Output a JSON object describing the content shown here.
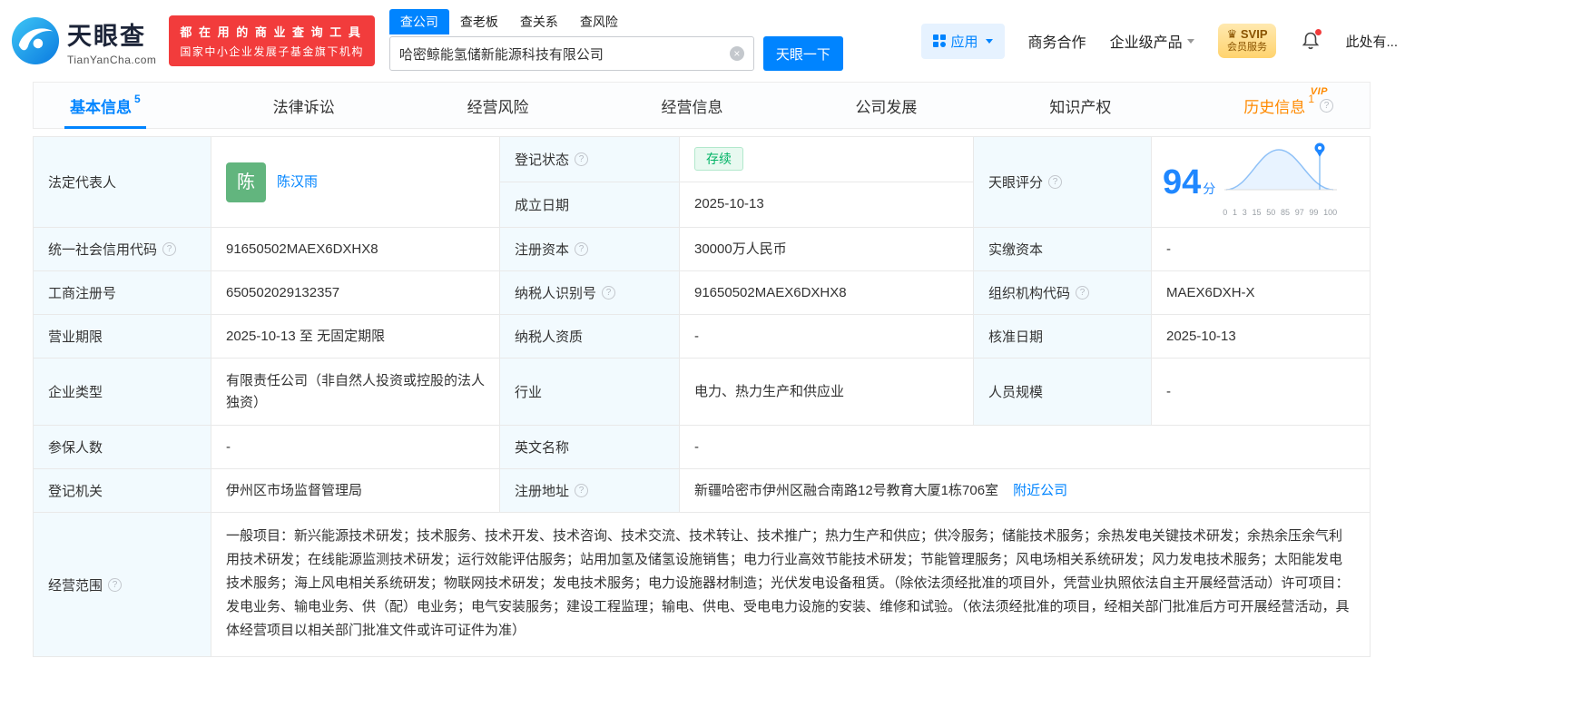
{
  "colors": {
    "brand_blue": "#0084ff",
    "promo_red": "#f23c3c",
    "status_green": "#00b365",
    "history_orange": "#ff8a00",
    "svip_gold": "#ffd36e",
    "label_cell_bg": "#f2fafe"
  },
  "header": {
    "logo_cn": "天眼查",
    "logo_en": "TianYanCha.com",
    "promo_line1": "都 在 用 的 商 业 查 询 工 具",
    "promo_line2": "国家中小企业发展子基金旗下机构",
    "search_tabs": [
      "查公司",
      "查老板",
      "查关系",
      "查风险"
    ],
    "search_value": "哈密鲸能氢储新能源科技有限公司",
    "search_button": "天眼一下",
    "nav_apps": "应用",
    "nav_cooperation": "商务合作",
    "nav_enterprise": "企业级产品",
    "svip_title": "SVIP",
    "svip_subtitle": "会员服务",
    "user_name": "此处有..."
  },
  "tabs": [
    {
      "label": "基本信息",
      "count": "5"
    },
    {
      "label": "法律诉讼",
      "count": ""
    },
    {
      "label": "经营风险",
      "count": ""
    },
    {
      "label": "经营信息",
      "count": ""
    },
    {
      "label": "公司发展",
      "count": ""
    },
    {
      "label": "知识产权",
      "count": ""
    },
    {
      "label": "历史信息",
      "count": "1",
      "vip": "VIP"
    }
  ],
  "info": {
    "legal_rep_label": "法定代表人",
    "legal_rep_avatar": "陈",
    "legal_rep_name": "陈汉雨",
    "reg_status_label": "登记状态",
    "reg_status_value": "存续",
    "establish_date_label": "成立日期",
    "establish_date_value": "2025-10-13",
    "score_label": "天眼评分",
    "score_value": "94",
    "score_unit": "分",
    "score_ticks": [
      "0",
      "1",
      "3",
      "15",
      "50",
      "85",
      "97",
      "99",
      "100"
    ],
    "credit_code_label": "统一社会信用代码",
    "credit_code_value": "91650502MAEX6DXHX8",
    "reg_capital_label": "注册资本",
    "reg_capital_value": "30000万人民币",
    "paid_capital_label": "实缴资本",
    "paid_capital_value": "-",
    "reg_number_label": "工商注册号",
    "reg_number_value": "650502029132357",
    "taxpayer_id_label": "纳税人识别号",
    "taxpayer_id_value": "91650502MAEX6DXHX8",
    "org_code_label": "组织机构代码",
    "org_code_value": "MAEX6DXH-X",
    "business_term_label": "营业期限",
    "business_term_value": "2025-10-13 至 无固定期限",
    "taxpayer_quality_label": "纳税人资质",
    "taxpayer_quality_value": "-",
    "approval_date_label": "核准日期",
    "approval_date_value": "2025-10-13",
    "company_type_label": "企业类型",
    "company_type_value": "有限责任公司（非自然人投资或控股的法人独资）",
    "industry_label": "行业",
    "industry_value": "电力、热力生产和供应业",
    "staff_size_label": "人员规模",
    "staff_size_value": "-",
    "insured_label": "参保人数",
    "insured_value": "-",
    "english_name_label": "英文名称",
    "english_name_value": "-",
    "reg_authority_label": "登记机关",
    "reg_authority_value": "伊州区市场监督管理局",
    "reg_address_label": "注册地址",
    "reg_address_value": "新疆哈密市伊州区融合南路12号教育大厦1栋706室",
    "nearby_link": "附近公司",
    "business_scope_label": "经营范围",
    "business_scope_value": "一般项目：新兴能源技术研发；技术服务、技术开发、技术咨询、技术交流、技术转让、技术推广；热力生产和供应；供冷服务；储能技术服务；余热发电关键技术研发；余热余压余气利用技术研发；在线能源监测技术研发；运行效能评估服务；站用加氢及储氢设施销售；电力行业高效节能技术研发；节能管理服务；风电场相关系统研发；风力发电技术服务；太阳能发电技术服务；海上风电相关系统研发；物联网技术研发；发电技术服务；电力设施器材制造；光伏发电设备租赁。（除依法须经批准的项目外，凭营业执照依法自主开展经营活动）许可项目：发电业务、输电业务、供（配）电业务；电气安装服务；建设工程监理；输电、供电、受电电力设施的安装、维修和试验。（依法须经批准的项目，经相关部门批准后方可开展经营活动，具体经营项目以相关部门批准文件或许可证件为准）"
  }
}
